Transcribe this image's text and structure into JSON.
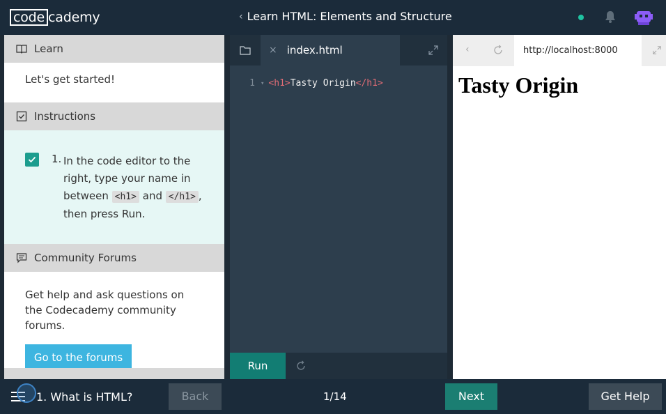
{
  "header": {
    "logo_boxed": "code",
    "logo_rest": "cademy",
    "course_title": "Learn HTML: Elements and Structure",
    "back_chevron": "‹"
  },
  "left": {
    "learn": {
      "title": "Learn",
      "icon": "book-icon",
      "body": "Let's get started!"
    },
    "instructions": {
      "title": "Instructions",
      "icon": "checkbox-icon",
      "items": [
        {
          "number": "1.",
          "text_part1": "In the code editor to the right, type your name in between",
          "code1": "<h1>",
          "text_part2": "and",
          "code2": "</h1>",
          "text_part3": ", then press Run.",
          "checked": true
        }
      ]
    },
    "forums": {
      "title": "Community Forums",
      "icon": "chat-icon",
      "body": "Get help and ask questions on the Codecademy community forums.",
      "button": "Go to the forums"
    }
  },
  "editor": {
    "tab_close": "×",
    "filename": "index.html",
    "lines": [
      {
        "num": "1",
        "open_tag": "<h1>",
        "text": "Tasty Origin",
        "close_tag": "</h1>"
      }
    ],
    "run_label": "Run"
  },
  "browser": {
    "back": "‹",
    "url": "http://localhost:8000",
    "rendered_heading": "Tasty Origin"
  },
  "footer": {
    "lesson_title": "1. What is HTML?",
    "back_label": "Back",
    "page": "1/14",
    "next_label": "Next",
    "help_label": "Get Help"
  },
  "colors": {
    "header_bg": "#1b2b3a",
    "editor_bg": "#2d3e4d",
    "run_green": "#127d73",
    "forum_blue": "#3db5e0",
    "instruction_bg": "#e6f7f5",
    "status_dot": "#1fc3a1",
    "avatar_purple": "#8b5cf6"
  }
}
